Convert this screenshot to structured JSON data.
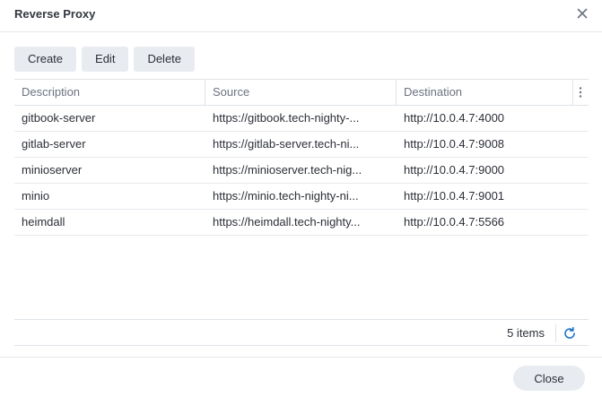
{
  "window": {
    "title": "Reverse Proxy"
  },
  "toolbar": {
    "create_label": "Create",
    "edit_label": "Edit",
    "delete_label": "Delete"
  },
  "table": {
    "columns": [
      "Description",
      "Source",
      "Destination"
    ],
    "rows": [
      {
        "description": "gitbook-server",
        "source": "https://gitbook.tech-nighty-...",
        "destination": "http://10.0.4.7:4000"
      },
      {
        "description": "gitlab-server",
        "source": "https://gitlab-server.tech-ni...",
        "destination": "http://10.0.4.7:9008"
      },
      {
        "description": "minioserver",
        "source": "https://minioserver.tech-nig...",
        "destination": "http://10.0.4.7:9000"
      },
      {
        "description": "minio",
        "source": "https://minio.tech-nighty-ni...",
        "destination": "http://10.0.4.7:9001"
      },
      {
        "description": "heimdall",
        "source": "https://heimdall.tech-nighty...",
        "destination": "http://10.0.4.7:5566"
      }
    ]
  },
  "footer": {
    "count_text": "5 items",
    "close_label": "Close"
  },
  "colors": {
    "accent": "#1a73c9",
    "button_bg": "#e8ecf1",
    "border": "#dfe3e8"
  },
  "icons": {
    "close": "close-icon",
    "menu": "more-vertical-icon",
    "refresh": "refresh-icon"
  }
}
